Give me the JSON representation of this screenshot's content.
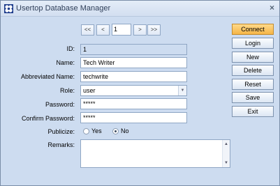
{
  "window": {
    "title": "Usertop Database Manager",
    "close_glyph": "×"
  },
  "navigator": {
    "first": "<<",
    "prev": "<",
    "page": "1",
    "next": ">",
    "last": ">>"
  },
  "form": {
    "id_label": "ID:",
    "id_value": "1",
    "name_label": "Name:",
    "name_value": "Tech Writer",
    "abbrev_label": "Abbreviated Name:",
    "abbrev_value": "techwrite",
    "role_label": "Role:",
    "role_value": "user",
    "password_label": "Password:",
    "password_value": "*****",
    "confirm_label": "Confirm Password:",
    "confirm_value": "*****",
    "publicize_label": "Publicize:",
    "publicize_options": [
      "Yes",
      "No"
    ],
    "publicize_selected": "No",
    "remarks_label": "Remarks:",
    "remarks_value": ""
  },
  "actions": {
    "connect": "Connect",
    "login": "Login",
    "new": "New",
    "delete": "Delete",
    "reset": "Reset",
    "save": "Save",
    "exit": "Exit"
  },
  "colors": {
    "window_bg": "#cddcf0",
    "primary_button": "#f5b547"
  },
  "icons": {
    "app": "app-logo-icon",
    "close": "close-icon",
    "dropdown": "chevron-down-icon"
  }
}
